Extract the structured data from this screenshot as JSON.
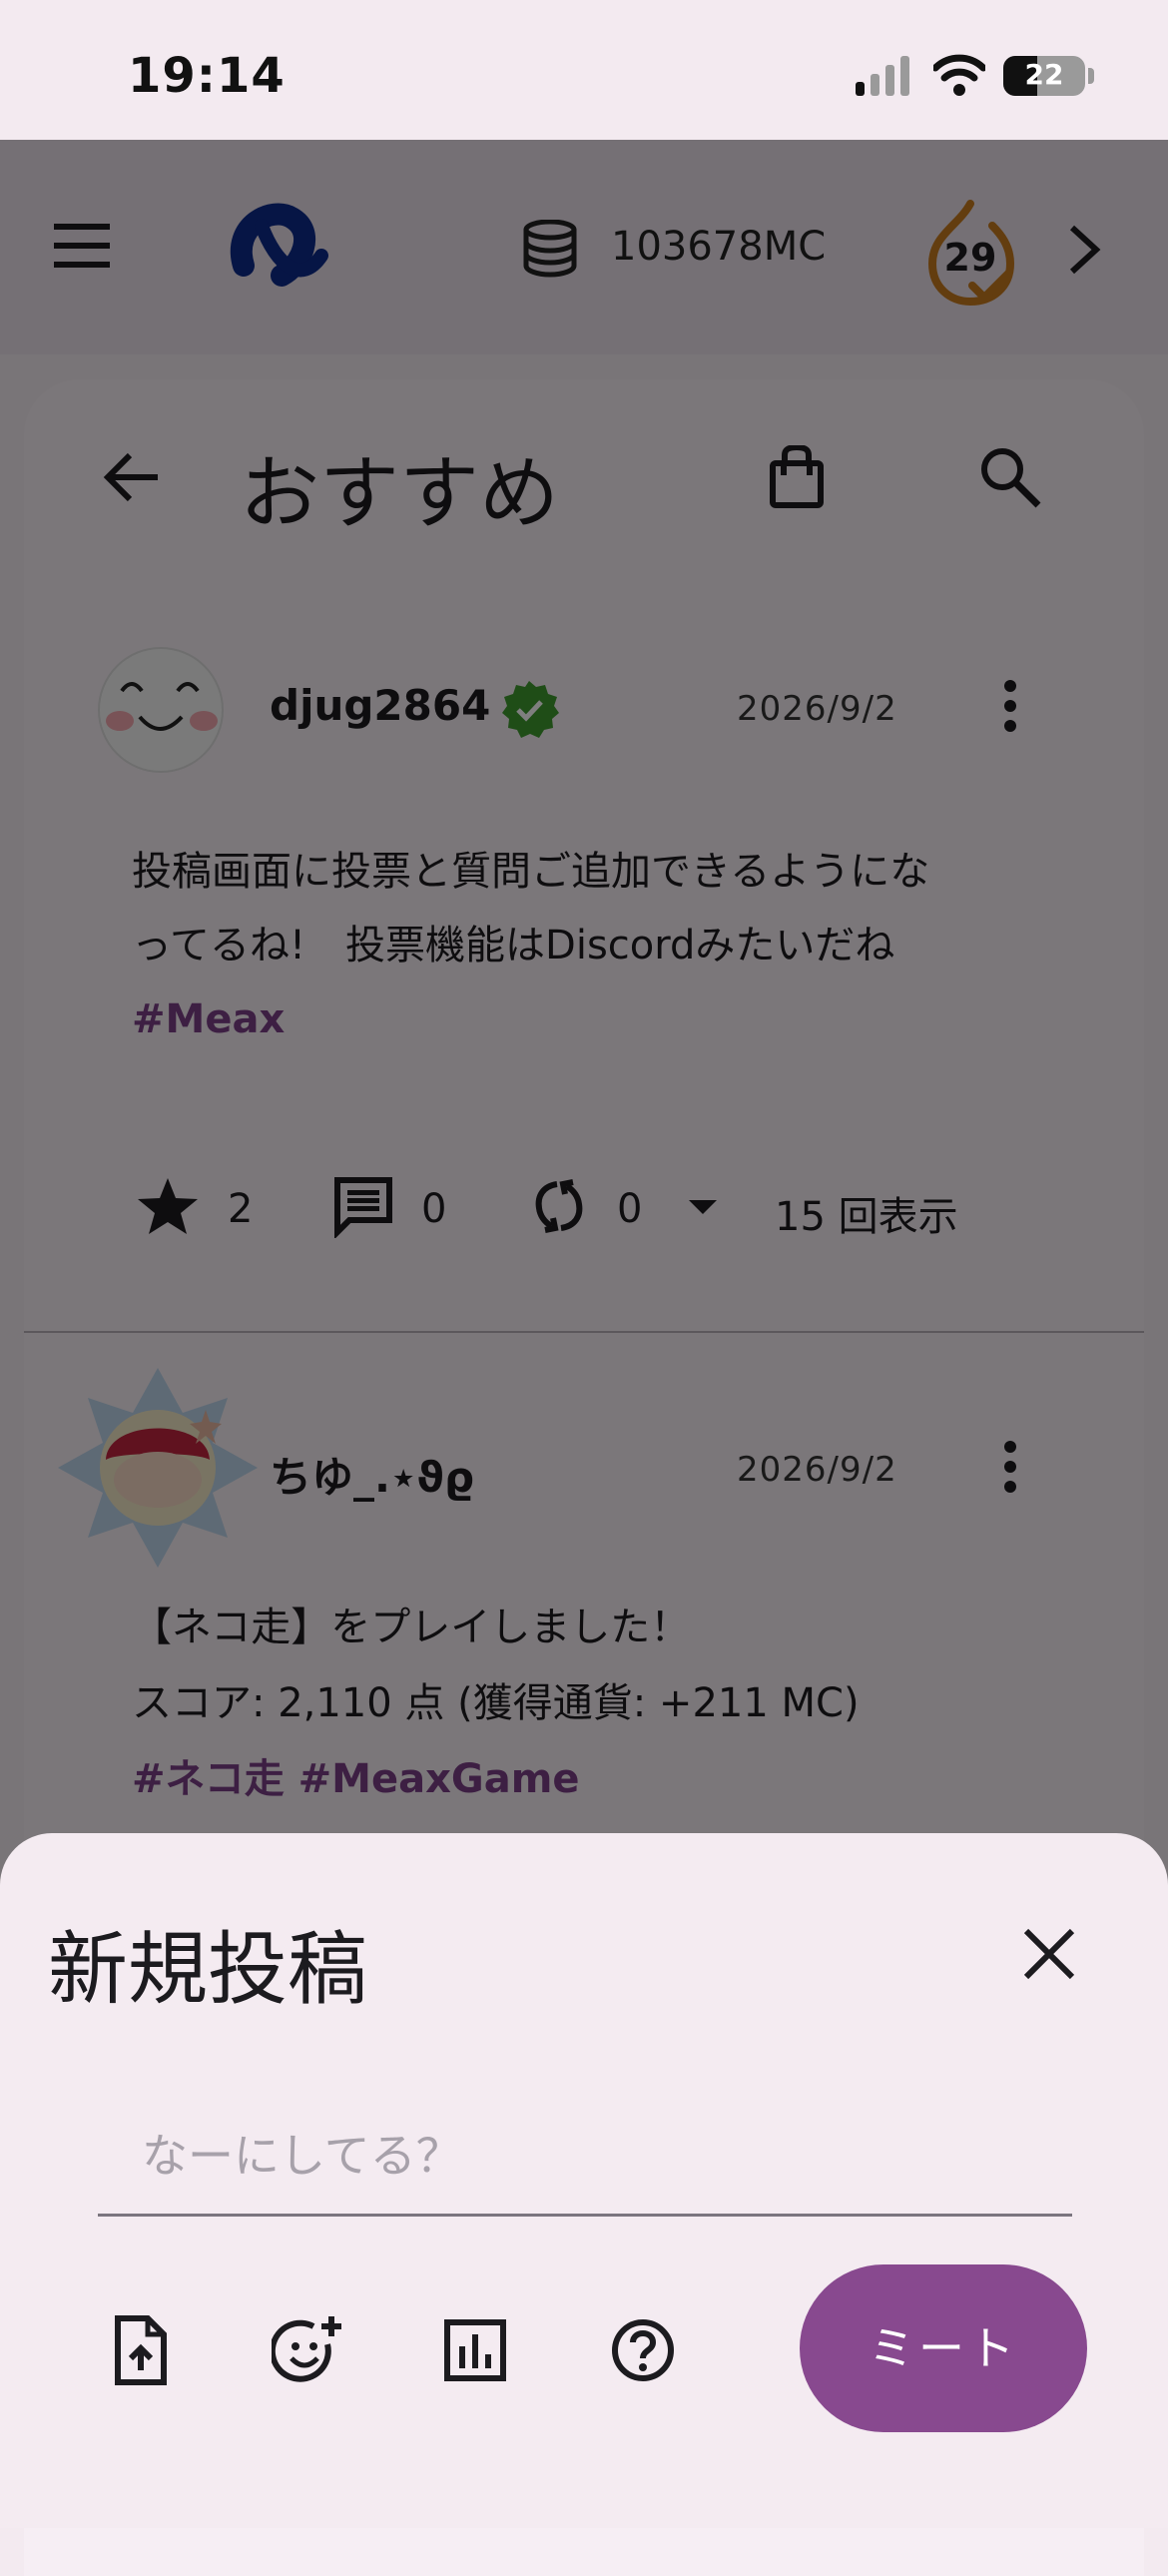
{
  "status_bar": {
    "time": "19:14",
    "battery": "22"
  },
  "app_bar": {
    "coins": "103678MC",
    "streak": "29"
  },
  "page": {
    "title": "おすすめ"
  },
  "posts": [
    {
      "username": "djug2864",
      "date": "2026/9/2",
      "lines": [
        "投稿画面に投票と質問ご追加できるようにな",
        "ってるね!　投票機能はDiscordみたいだね"
      ],
      "hashtags": "#Meax",
      "stars": "2",
      "comments": "0",
      "reposts": "0",
      "views": "15 回表示"
    },
    {
      "username": "ちゆ_.⋆ϑϱ",
      "date": "2026/9/2",
      "lines": [
        "【ネコ走】をプレイしました！",
        "スコア: 2,110 点 (獲得通貨: +211 MC)"
      ],
      "hashtags": "#ネコ走 #MeaxGame"
    }
  ],
  "sheet": {
    "title": "新規投稿",
    "placeholder": "なーにしてる？",
    "submit": "ミート"
  },
  "colors": {
    "accent": "#88498f",
    "hashtag": "#7a3e86",
    "verified": "#3f9a2e",
    "streak": "#c77a1e"
  }
}
